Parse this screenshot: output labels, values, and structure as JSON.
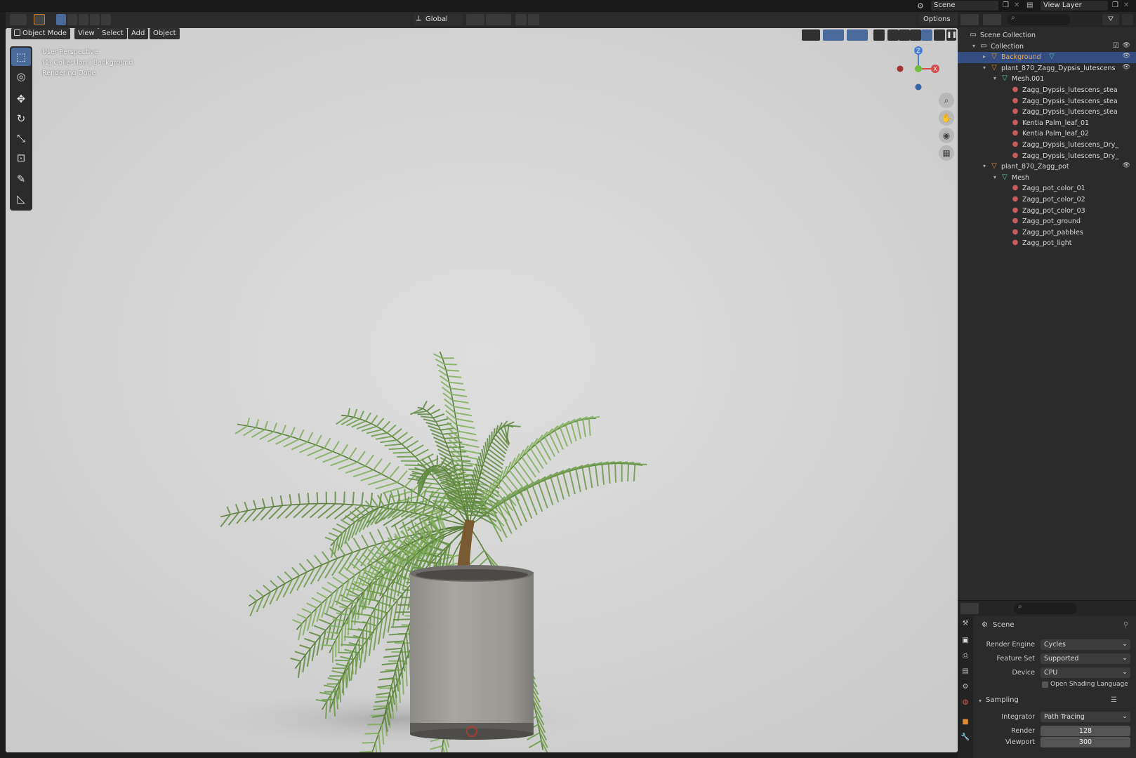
{
  "topbar": {
    "scene_label": "Scene",
    "view_layer_label": "View Layer"
  },
  "viewport_header": {
    "mode": "Object Mode",
    "menus": [
      "View",
      "Select",
      "Add",
      "Object"
    ],
    "orientation": "Global",
    "options_label": "Options"
  },
  "viewport": {
    "overlay_lines": [
      "User Perspective",
      "(1) Collection | Background",
      "Rendering Done"
    ]
  },
  "gizmo": {
    "z_label": "Z",
    "y_label": "Y",
    "x_label": "X"
  },
  "outliner": {
    "rows": [
      {
        "label": "Scene Collection",
        "icon": "collection-icon",
        "depth": 0,
        "tri": "",
        "eye": false,
        "check": false
      },
      {
        "label": "Collection",
        "icon": "collection-icon",
        "depth": 1,
        "tri": "▾",
        "eye": true,
        "check": true
      },
      {
        "label": "Background",
        "icon": "object-icon",
        "depth": 2,
        "tri": "▸",
        "eye": true,
        "selected": true,
        "extra": "mesh-data-icon"
      },
      {
        "label": "plant_870_Zagg_Dypsis_lutescens",
        "icon": "object-icon",
        "depth": 2,
        "tri": "▾",
        "eye": true
      },
      {
        "label": "Mesh.001",
        "icon": "mesh-data-icon",
        "depth": 3,
        "tri": "▾",
        "eye": false
      },
      {
        "label": "Zagg_Dypsis_lutescens_stea",
        "icon": "material-icon",
        "depth": 4,
        "tri": "",
        "eye": false
      },
      {
        "label": "Zagg_Dypsis_lutescens_stea",
        "icon": "material-icon",
        "depth": 4,
        "tri": "",
        "eye": false
      },
      {
        "label": "Zagg_Dypsis_lutescens_stea",
        "icon": "material-icon",
        "depth": 4,
        "tri": "",
        "eye": false
      },
      {
        "label": "Kentia Palm_leaf_01",
        "icon": "material-icon",
        "depth": 4,
        "tri": "",
        "eye": false
      },
      {
        "label": "Kentia Palm_leaf_02",
        "icon": "material-icon",
        "depth": 4,
        "tri": "",
        "eye": false
      },
      {
        "label": "Zagg_Dypsis_lutescens_Dry_",
        "icon": "material-icon",
        "depth": 4,
        "tri": "",
        "eye": false
      },
      {
        "label": "Zagg_Dypsis_lutescens_Dry_",
        "icon": "material-icon",
        "depth": 4,
        "tri": "",
        "eye": false
      },
      {
        "label": "plant_870_Zagg_pot",
        "icon": "object-icon",
        "depth": 2,
        "tri": "▾",
        "eye": true
      },
      {
        "label": "Mesh",
        "icon": "mesh-data-icon",
        "depth": 3,
        "tri": "▾",
        "eye": false
      },
      {
        "label": "Zagg_pot_color_01",
        "icon": "material-icon",
        "depth": 4,
        "tri": "",
        "eye": false
      },
      {
        "label": "Zagg_pot_color_02",
        "icon": "material-icon",
        "depth": 4,
        "tri": "",
        "eye": false
      },
      {
        "label": "Zagg_pot_color_03",
        "icon": "material-icon",
        "depth": 4,
        "tri": "",
        "eye": false
      },
      {
        "label": "Zagg_pot_ground",
        "icon": "material-icon",
        "depth": 4,
        "tri": "",
        "eye": false
      },
      {
        "label": "Zagg_pot_pabbles",
        "icon": "material-icon",
        "depth": 4,
        "tri": "",
        "eye": false
      },
      {
        "label": "Zagg_pot_light",
        "icon": "material-icon",
        "depth": 4,
        "tri": "",
        "eye": false
      }
    ]
  },
  "properties": {
    "context": "Scene",
    "render_engine_label": "Render Engine",
    "render_engine": "Cycles",
    "feature_set_label": "Feature Set",
    "feature_set": "Supported",
    "device_label": "Device",
    "device": "CPU",
    "osl_label": "Open Shading Language",
    "sampling_label": "Sampling",
    "integrator_label": "Integrator",
    "integrator": "Path Tracing",
    "render_label": "Render",
    "render_samples": "128",
    "viewport_label": "Viewport",
    "viewport_samples": "300"
  },
  "colors": {
    "selection": "#334d80",
    "viewport_bg": "#d4d4d4",
    "leaf": "#6f9e4c",
    "pot": "#9c9a94"
  }
}
